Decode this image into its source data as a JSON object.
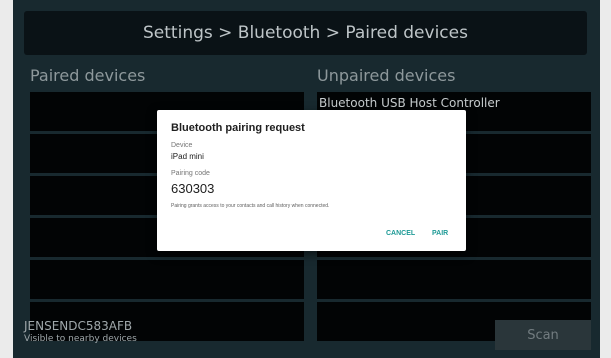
{
  "header": {
    "title": "Settings > Bluetooth > Paired devices"
  },
  "paired": {
    "title": "Paired devices",
    "rows": [
      "",
      "",
      "",
      "",
      "",
      ""
    ]
  },
  "unpaired": {
    "title": "Unpaired devices",
    "rows": [
      "Bluetooth USB Host Controller",
      "",
      "",
      "",
      "",
      ""
    ]
  },
  "footer": {
    "device_name": "JENSENDC583AFB",
    "visibility": "Visible to nearby devices",
    "scan_label": "Scan"
  },
  "dialog": {
    "title": "Bluetooth pairing request",
    "device_label": "Device",
    "device_value": "iPad mini",
    "code_label": "Pairing code",
    "code_value": "630303",
    "note": "Pairing grants access to your contacts and call history when connected.",
    "cancel_label": "CANCEL",
    "pair_label": "PAIR",
    "accent_color": "#1e9a96"
  }
}
